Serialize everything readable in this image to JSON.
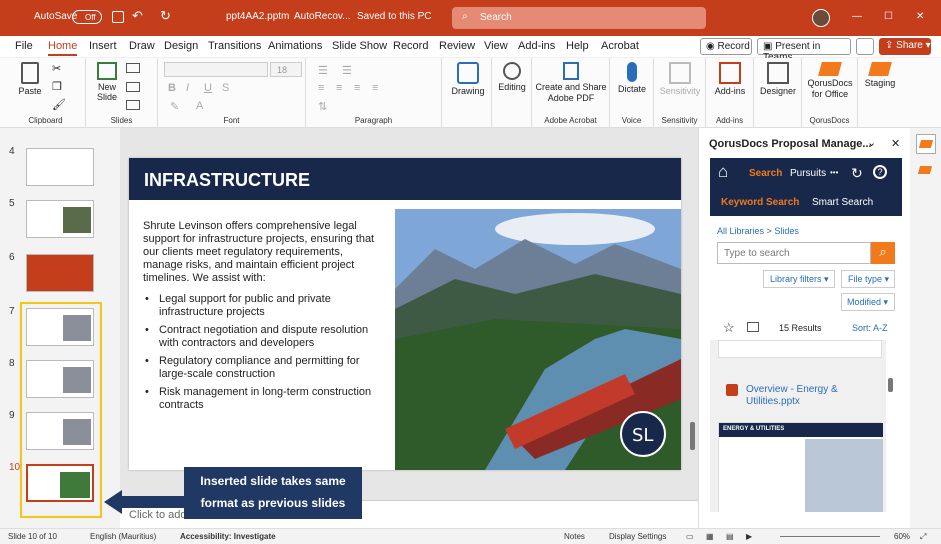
{
  "titlebar": {
    "autosave": "AutoSave",
    "autosave_state": "Off",
    "filename": "ppt4AA2.pptm",
    "autorecover": "AutoRecov...",
    "saved": "Saved to this PC",
    "search_placeholder": "Search"
  },
  "tabs": [
    "File",
    "Home",
    "Insert",
    "Draw",
    "Design",
    "Transitions",
    "Animations",
    "Slide Show",
    "Record",
    "Review",
    "View",
    "Add-ins",
    "Help",
    "Acrobat"
  ],
  "right_buttons": {
    "record": "Record",
    "teams": "Present in Teams",
    "share": "Share"
  },
  "ribbon": {
    "paste": "Paste",
    "clipboard": "Clipboard",
    "new_slide": "New\nSlide",
    "slides": "Slides",
    "font_size": "18",
    "font": "Font",
    "paragraph": "Paragraph",
    "drawing": "Drawing",
    "editing": "Editing",
    "create_share": "Create and Share\nAdobe PDF",
    "adobe_acrobat": "Adobe Acrobat",
    "dictate": "Dictate",
    "voice": "Voice",
    "sensitivity": "Sensitivity",
    "sensitivity_grp": "Sensitivity",
    "addins": "Add-ins",
    "addins_grp": "Add-ins",
    "designer": "Designer",
    "qorus": "QorusDocs\nfor Office",
    "qorusdocs_grp": "QorusDocs",
    "staging": "Staging"
  },
  "thumb_numbers": [
    "4",
    "5",
    "6",
    "7",
    "8",
    "9",
    "10"
  ],
  "slide": {
    "title": "INFRASTRUCTURE",
    "intro": "Shrute Levinson offers comprehensive legal support for infrastructure projects, ensuring that our clients meet regulatory requirements, manage risks, and maintain efficient project timelines. We assist with:",
    "bullets": [
      "Legal support for public and private infrastructure projects",
      "Contract negotiation and dispute resolution with contractors and developers",
      "Regulatory compliance and permitting for large-scale construction",
      "Risk management in long-term construction contracts"
    ],
    "logo": "SL"
  },
  "notes_placeholder": "Click to add",
  "callout": "Inserted slide takes same format as previous slides",
  "pane": {
    "title": "QorusDocs Proposal Manage...",
    "nav_search": "Search",
    "nav_pursuits": "Pursuits",
    "nav_more": "•••",
    "keyword_search": "Keyword Search",
    "smart_search": "Smart Search",
    "breadcrumb_root": "All Libraries",
    "breadcrumb_sep": ">",
    "breadcrumb_leaf": "Slides",
    "search_placeholder": "Type to search",
    "library_filters": "Library filters",
    "file_type": "File type",
    "modified": "Modified",
    "results": "15 Results",
    "sort": "Sort:  A-Z",
    "result_title": "Overview - Energy & Utilities.pptx",
    "preview_heading": "ENERGY & UTILITIES"
  },
  "status": {
    "slide": "Slide 10 of 10",
    "language": "English (Mauritius)",
    "accessibility": "Accessibility: Investigate",
    "notes": "Notes",
    "display": "Display Settings",
    "zoom": "60%"
  },
  "colors": {
    "titlebar": "#c43e1c",
    "slide_header": "#17284a",
    "accent": "#f07a1c",
    "callout": "#1f3864",
    "thumb_highlight": "#f5c518"
  }
}
